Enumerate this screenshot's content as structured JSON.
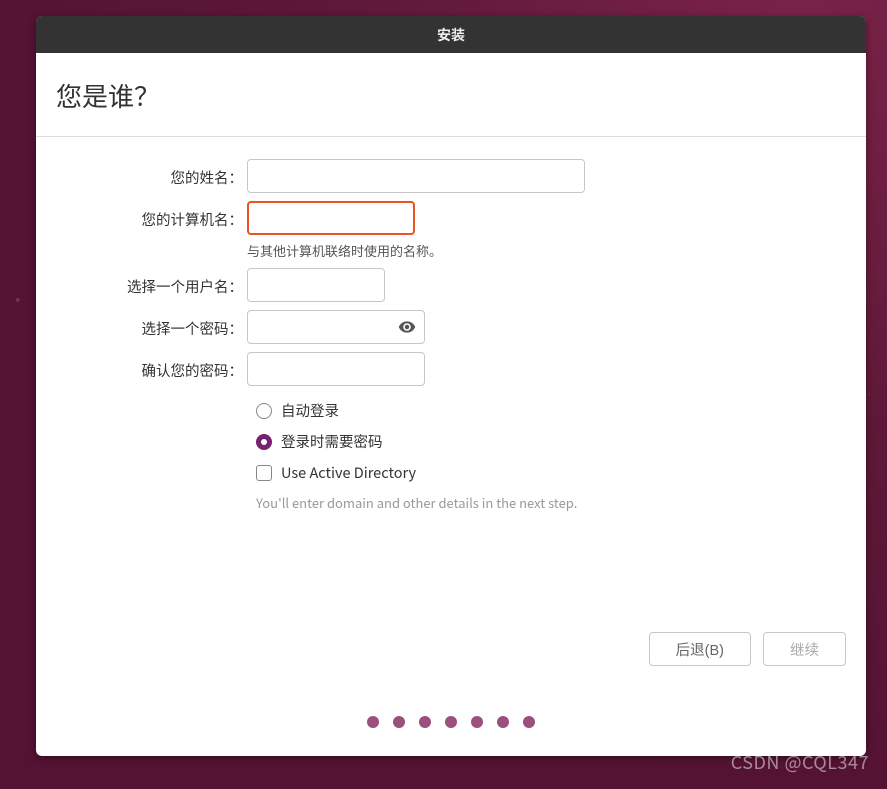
{
  "window": {
    "title": "安装"
  },
  "heading": "您是谁？",
  "form": {
    "name": {
      "label": "您的姓名：",
      "value": ""
    },
    "computer": {
      "label": "您的计算机名：",
      "value": "",
      "hint": "与其他计算机联络时使用的名称。"
    },
    "username": {
      "label": "选择一个用户名：",
      "value": ""
    },
    "password": {
      "label": "选择一个密码：",
      "value": ""
    },
    "confirm": {
      "label": "确认您的密码：",
      "value": ""
    }
  },
  "options": {
    "auto_login": {
      "label": "自动登录",
      "selected": false
    },
    "require_password": {
      "label": "登录时需要密码",
      "selected": true
    },
    "active_directory": {
      "label": "Use Active Directory",
      "checked": false,
      "hint": "You'll enter domain and other details in the next step."
    }
  },
  "buttons": {
    "back": "后退(B)",
    "continue": "继续"
  },
  "progress_dots": 7,
  "watermark": "CSDN @CQL347"
}
